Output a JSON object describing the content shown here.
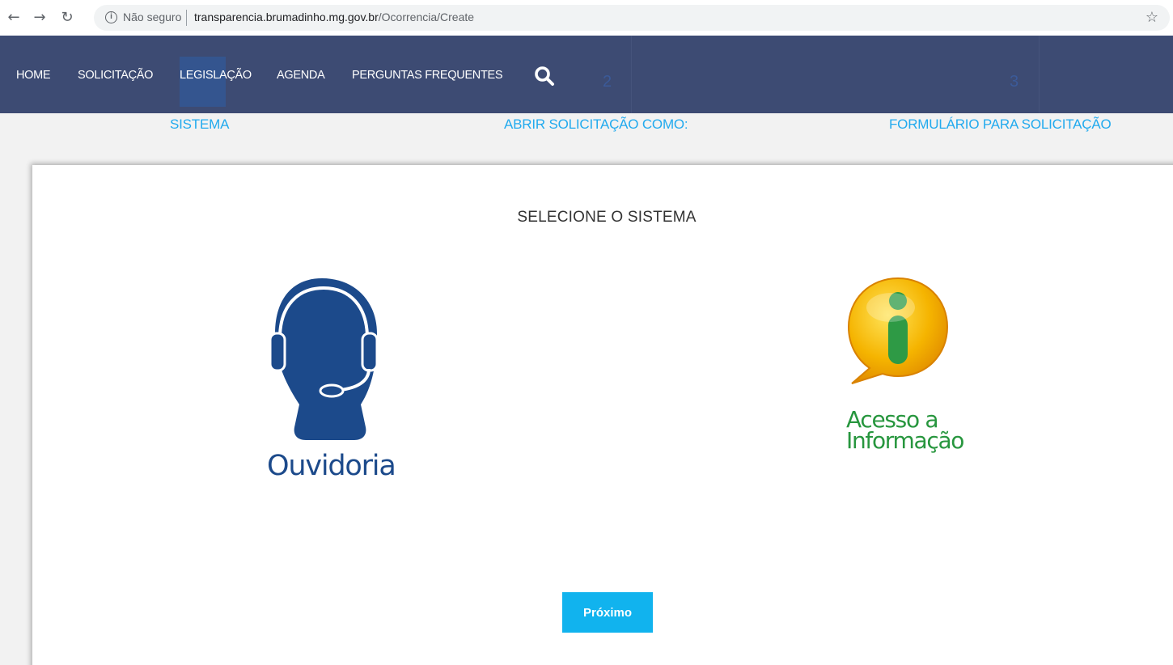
{
  "browser": {
    "back_icon": "arrow-left-icon",
    "forward_icon": "arrow-right-icon",
    "reload_icon": "reload-icon",
    "security_label": "Não seguro",
    "url_domain": "transparencia.brumadinho.mg.gov.br",
    "url_path": "/Ocorrencia/Create",
    "bookmark_icon": "star-icon"
  },
  "nav": {
    "background": "#3d4b73",
    "items": [
      {
        "label": "HOME"
      },
      {
        "label": "SOLICITAÇÃO"
      },
      {
        "label": "LEGISLAÇÃO"
      },
      {
        "label": "AGENDA"
      },
      {
        "label": "PERGUNTAS FREQUENTES"
      }
    ],
    "search_icon": "search-icon",
    "step_numbers": [
      "2",
      "3"
    ]
  },
  "steps": [
    {
      "label": "SISTEMA"
    },
    {
      "label": "ABRIR SOLICITAÇÃO COMO:"
    },
    {
      "label": "FORMULÁRIO PARA SOLICITAÇÃO"
    }
  ],
  "main": {
    "title": "SELECIONE O SISTEMA",
    "options": [
      {
        "label": "Ouvidoria",
        "icon": "headset-person-icon"
      },
      {
        "label_line1": "Acesso a",
        "label_line2": "Informação",
        "icon": "info-bubble-icon"
      }
    ],
    "next_button": "Próximo"
  },
  "colors": {
    "accent": "#11b3ee",
    "step_text": "#22aaee",
    "ouvidoria_blue": "#1c4a8b",
    "info_green": "#27963e",
    "info_orange": "#f5a300"
  }
}
